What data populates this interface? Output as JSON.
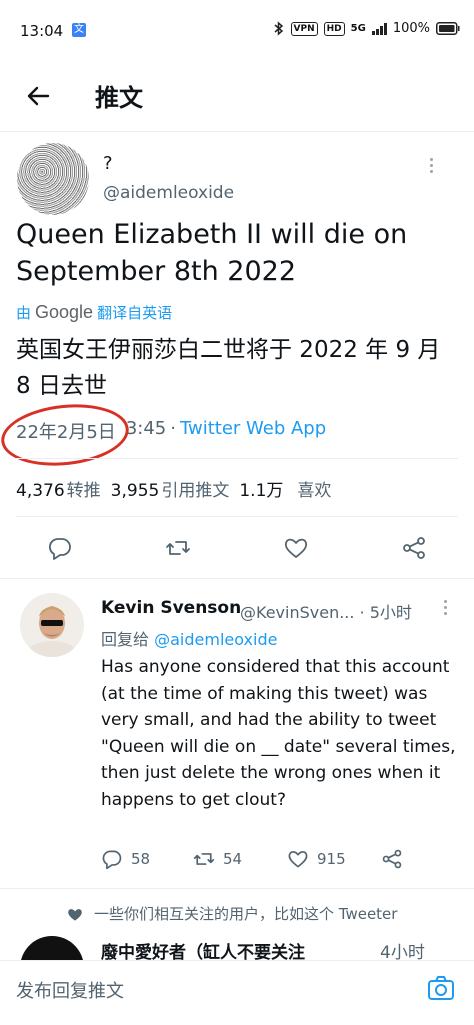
{
  "status_bar": {
    "time": "13:04",
    "translate_indicator": "文",
    "bluetooth_icon": "bluetooth-icon",
    "vpn_label": "VPN",
    "hd_label": "HD",
    "network_label": "5G",
    "battery": "100%"
  },
  "header": {
    "back_icon": "back-arrow-icon",
    "title": "推文"
  },
  "tweet": {
    "author_name": "?",
    "author_handle": "@aidemleoxide",
    "text": "Queen Elizabeth II will die on September 8th 2022",
    "translated_by_prefix": "由",
    "translated_by_brand": "Google",
    "translated_by_suffix": "翻译自英语",
    "translation": "英国女王伊丽莎白二世将于 2022 年 9 月 8 日去世",
    "date": "22年2月5日",
    "time": "3:45",
    "separator": "·",
    "source": "Twitter Web App",
    "stats": {
      "retweets_count": "4,376",
      "retweets_label": "转推",
      "quotes_count": "3,955",
      "quotes_label": "引用推文",
      "likes_count": "1.1万",
      "likes_label": "喜欢"
    },
    "highlight_color": "#d93025"
  },
  "reply": {
    "name": "Kevin Svenson",
    "handle_time": "@KevinSven... · 5小时",
    "reply_to_prefix": "回复给",
    "reply_to_handle": "@aidemleoxide",
    "text": "Has anyone considered that this account (at the time of making this tweet) was very small, and had the ability to tweet \"Queen will die on __ date\" several times, then just delete the wrong ones when it happens to get clout?",
    "replies": "58",
    "retweets": "54",
    "likes": "915"
  },
  "next_reply": {
    "followed_text": "一些你们相互关注的用户，比如这个 Tweeter",
    "name": "廢中愛好者（缸人不要关注",
    "time": "4小时"
  },
  "compose": {
    "placeholder": "发布回复推文",
    "camera_icon": "camera-icon"
  },
  "colors": {
    "accent": "#1d9bf0",
    "text": "#0f1419",
    "muted": "#536471"
  }
}
